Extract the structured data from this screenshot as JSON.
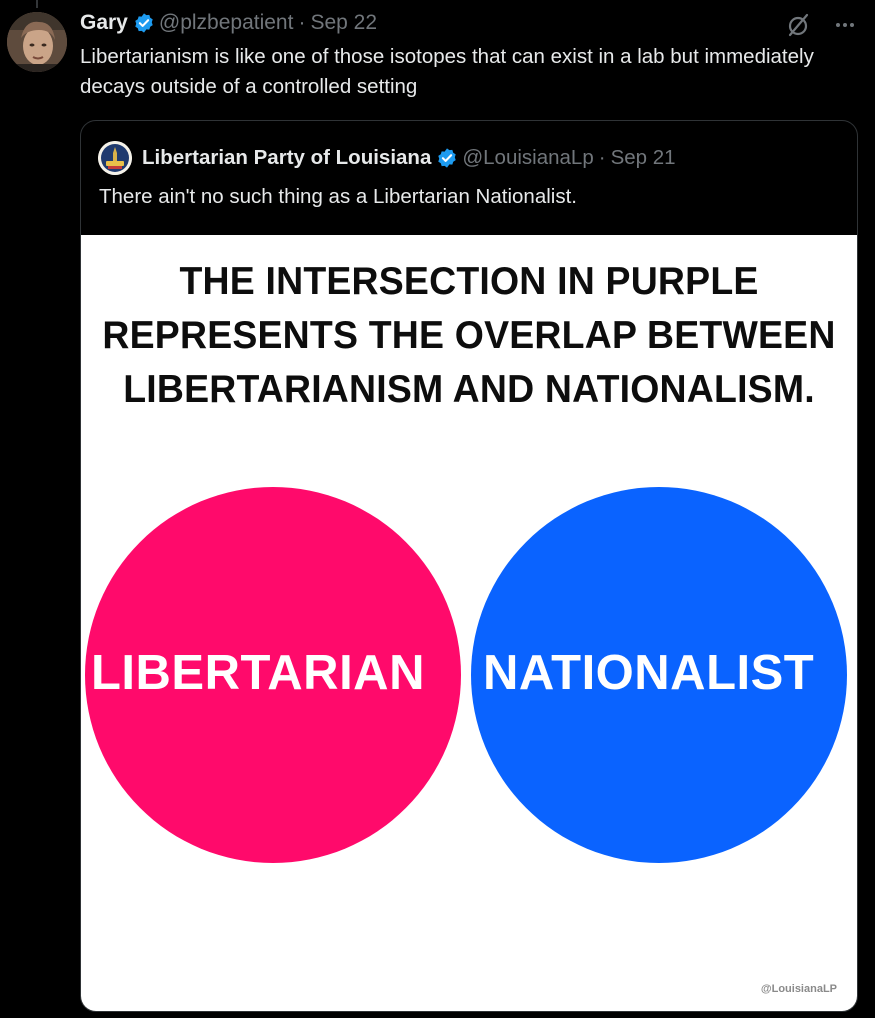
{
  "tweet": {
    "author_name": "Gary",
    "handle": "@plzbepatient",
    "separator": "·",
    "date": "Sep 22",
    "text": "Libertarianism is like one of those isotopes that can exist in a lab but immediately decays outside of a controlled setting",
    "icons": [
      "verified-badge-icon",
      "grok-icon",
      "more-icon"
    ]
  },
  "quoted_tweet": {
    "author_name": "Libertarian Party of Louisiana",
    "handle": "@LouisianaLp",
    "separator": "·",
    "date": "Sep 21",
    "text": "There ain't no such thing as a Libertarian Nationalist."
  },
  "meme": {
    "title_lines": [
      "THE INTERSECTION IN PURPLE",
      "REPRESENTS THE OVERLAP BETWEEN",
      "LIBERTARIANISM AND NATIONALISM."
    ],
    "left_circle_label": "LIBERTARIAN",
    "right_circle_label": "NATIONALIST",
    "watermark": "@LouisianaLP",
    "colors": {
      "left_circle": "#ff0a6b",
      "right_circle": "#0a63ff"
    }
  },
  "theme": {
    "accent_verified": "#1d9bf0",
    "text_primary": "#e7e9ea",
    "text_secondary": "#71767b"
  }
}
